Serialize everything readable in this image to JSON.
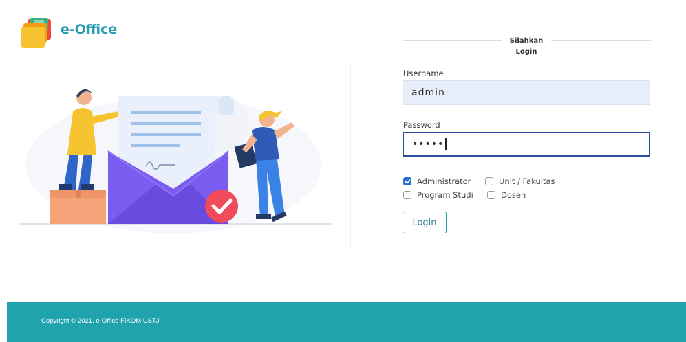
{
  "brand": {
    "name": "e-Office"
  },
  "login": {
    "title_line1": "Silahkan",
    "title_line2": "Login",
    "username_label": "Username",
    "username_value": "admin",
    "password_label": "Password",
    "password_value": "•••••",
    "roles": [
      {
        "label": "Administrator",
        "checked": true
      },
      {
        "label": "Unit / Fakultas",
        "checked": false
      },
      {
        "label": "Program Studi",
        "checked": false
      },
      {
        "label": "Dosen",
        "checked": false
      }
    ],
    "button_label": "Login"
  },
  "footer": {
    "text": "Copyright © 2021. e-Office FIKOM USTJ."
  },
  "colors": {
    "teal": "#21a3ae",
    "brand_text": "#2a9bb3",
    "check_blue": "#2b6fd6",
    "envelope_purple": "#7b5cf0",
    "check_red": "#f04b5b"
  }
}
